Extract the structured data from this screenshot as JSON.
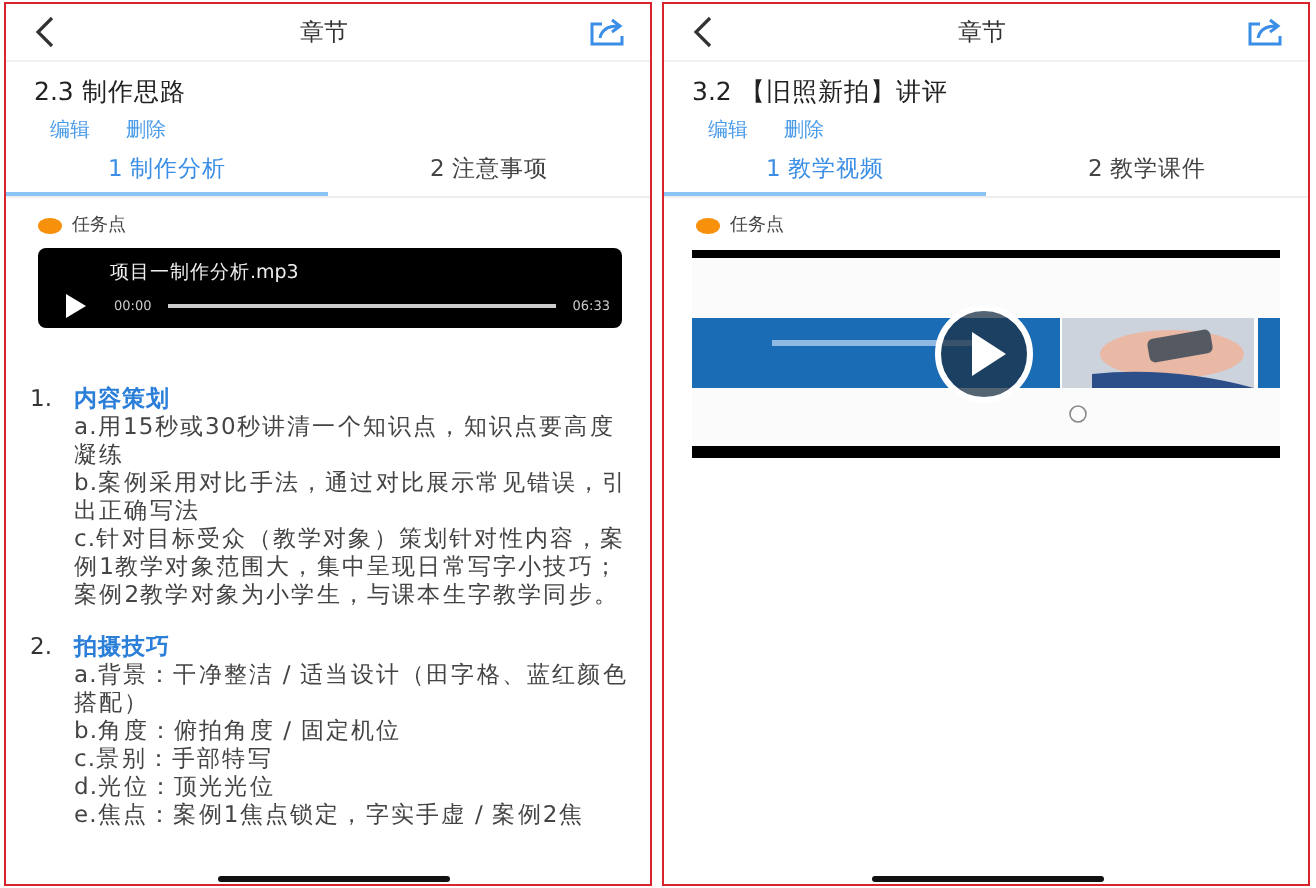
{
  "panels": [
    {
      "header": {
        "title": "章节"
      },
      "lesson_title": "2.3 制作思路",
      "actions": [
        "编辑",
        "删除"
      ],
      "tabs": [
        {
          "label": "1 制作分析",
          "selected": true
        },
        {
          "label": "2 注意事项",
          "selected": false
        }
      ],
      "task_label": "任务点",
      "media": {
        "kind": "audio",
        "file_name": "项目一制作分析.mp3",
        "current_time": "00:00",
        "duration": "06:33"
      },
      "content": [
        {
          "number": "1.",
          "heading": "内容策划",
          "lines": [
            "a.用15秒或30秒讲清一个知识点，知识点要高度凝练",
            "b.案例采用对比手法，通过对比展示常见错误，引出正确写法",
            "c.针对目标受众（教学对象）策划针对性内容，案例1教学对象范围大，集中呈现日常写字小技巧；案例2教学对象为小学生，与课本生字教学同步。"
          ]
        },
        {
          "number": "2.",
          "heading": "拍摄技巧",
          "lines": [
            "a.背景：干净整洁 / 适当设计（田字格、蓝红颜色搭配）",
            "b.角度：俯拍角度 / 固定机位",
            "c.景别：手部特写",
            "d.光位：顶光光位",
            "e.焦点：案例1焦点锁定，字实手虚 / 案例2焦"
          ]
        }
      ]
    },
    {
      "header": {
        "title": "章节"
      },
      "lesson_title": "3.2 【旧照新拍】讲评",
      "actions": [
        "编辑",
        "删除"
      ],
      "tabs": [
        {
          "label": "1 教学视频",
          "selected": true
        },
        {
          "label": "2 教学课件",
          "selected": false
        }
      ],
      "task_label": "任务点",
      "media": {
        "kind": "video"
      }
    }
  ]
}
